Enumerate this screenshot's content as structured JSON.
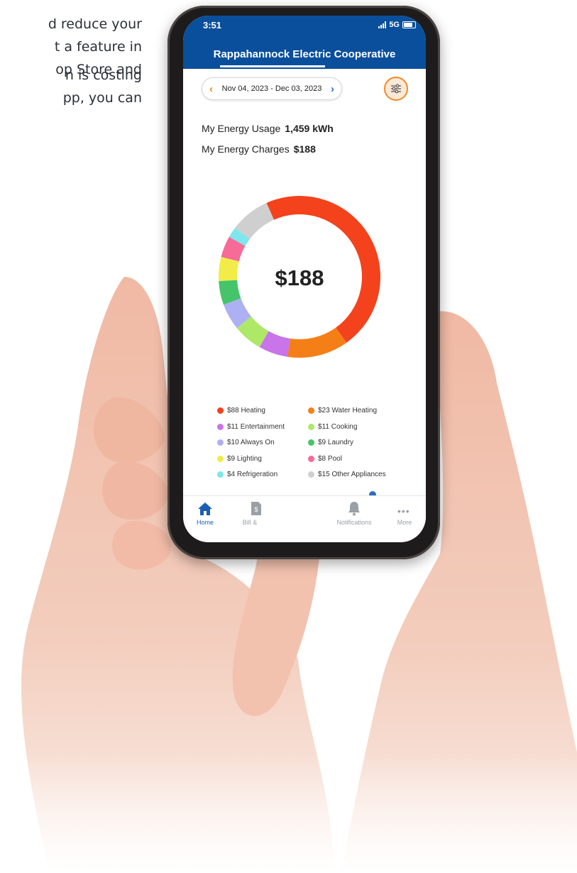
{
  "background_text": {
    "para1": [
      "d reduce your",
      "t a feature in",
      "op Store and"
    ],
    "para2": [
      "n is costing",
      "pp, you can"
    ]
  },
  "status_bar": {
    "time": "3:51",
    "network": "5G"
  },
  "header": {
    "title": "Rappahannock Electric Cooperative"
  },
  "date_range": {
    "label": "Nov 04, 2023 - Dec 03, 2023",
    "prev_icon": "chevron-left-icon",
    "next_icon": "chevron-right-icon"
  },
  "filter": {
    "icon": "sliders-icon"
  },
  "summary": {
    "usage_label": "My Energy Usage",
    "usage_value": "1,459 kWh",
    "charges_label": "My Energy Charges",
    "charges_value": "$188"
  },
  "donut": {
    "center_label": "$188",
    "total": 188,
    "segments": [
      {
        "label": "Heating",
        "value": 88,
        "color": "#f4421c"
      },
      {
        "label": "Water Heating",
        "value": 23,
        "color": "#f47f17"
      },
      {
        "label": "Entertainment",
        "value": 11,
        "color": "#c974e8"
      },
      {
        "label": "Cooking",
        "value": 11,
        "color": "#aee868"
      },
      {
        "label": "Always On",
        "value": 10,
        "color": "#adb0f2"
      },
      {
        "label": "Laundry",
        "value": 9,
        "color": "#46c46a"
      },
      {
        "label": "Lighting",
        "value": 9,
        "color": "#f2ec49"
      },
      {
        "label": "Pool",
        "value": 8,
        "color": "#f66b98"
      },
      {
        "label": "Refrigeration",
        "value": 4,
        "color": "#7ee6ee"
      },
      {
        "label": "Other Appliances",
        "value": 15,
        "color": "#cfcfcf"
      }
    ]
  },
  "legend": [
    {
      "text": "$88 Heating",
      "color": "#f4421c"
    },
    {
      "text": "$23 Water Heating",
      "color": "#f47f17"
    },
    {
      "text": "$11 Entertainment",
      "color": "#c974e8"
    },
    {
      "text": "$11 Cooking",
      "color": "#aee868"
    },
    {
      "text": "$10 Always On",
      "color": "#adb0f2"
    },
    {
      "text": "$9 Laundry",
      "color": "#46c46a"
    },
    {
      "text": "$9 Lighting",
      "color": "#f2ec49"
    },
    {
      "text": "$8 Pool",
      "color": "#f66b98"
    },
    {
      "text": "$4 Refrigeration",
      "color": "#7ee6ee"
    },
    {
      "text": "$15 Other Appliances",
      "color": "#cfcfcf"
    }
  ],
  "tabs": [
    {
      "label": "Home",
      "icon": "home-icon",
      "active": true
    },
    {
      "label": "Bill &",
      "icon": "bill-icon",
      "active": false
    },
    {
      "label": "Notifications",
      "icon": "bell-icon",
      "active": false
    },
    {
      "label": "More",
      "icon": "more-icon",
      "active": false
    }
  ],
  "colors": {
    "header_blue": "#0a4f9c",
    "accent_orange": "#f08a24",
    "link_blue": "#2d6cc4"
  }
}
